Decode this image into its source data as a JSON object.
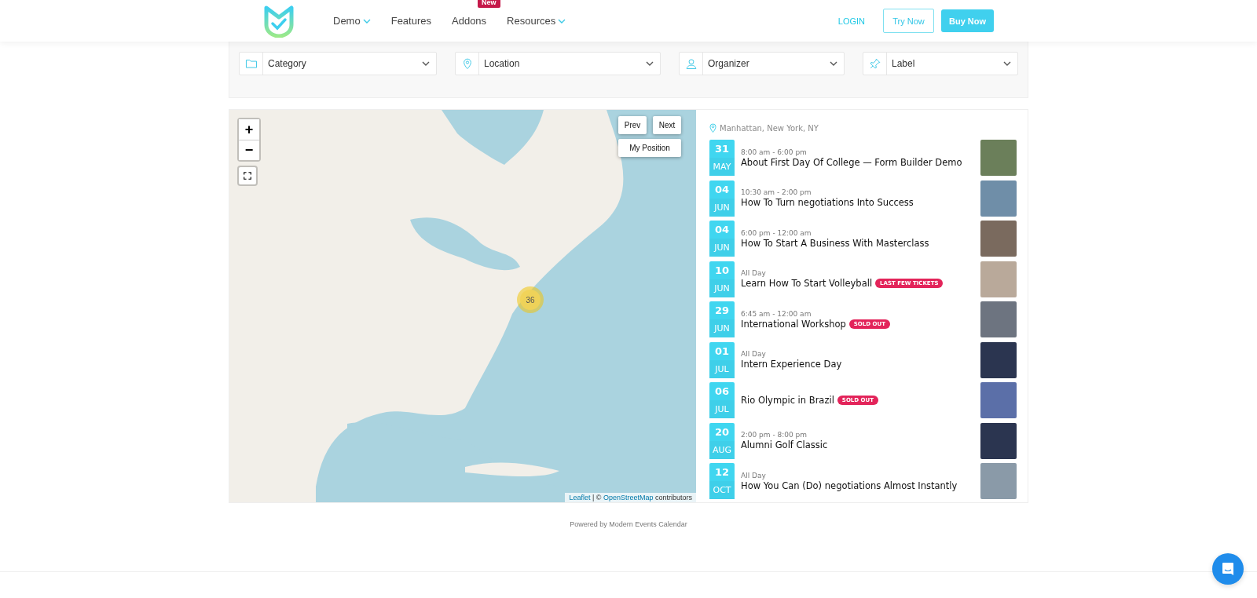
{
  "header": {
    "nav": [
      {
        "label": "Demo",
        "dropdown": true
      },
      {
        "label": "Features",
        "dropdown": false
      },
      {
        "label": "Addons",
        "dropdown": false,
        "badge": "New"
      },
      {
        "label": "Resources",
        "dropdown": true
      }
    ],
    "login": "LOGIN",
    "try_now": "Try Now",
    "buy_now": "Buy Now"
  },
  "filters": [
    {
      "label": "Category"
    },
    {
      "label": "Location"
    },
    {
      "label": "Organizer"
    },
    {
      "label": "Label"
    }
  ],
  "map": {
    "zoom_in": "+",
    "zoom_out": "−",
    "prev": "Prev",
    "next": "Next",
    "my_position": "My Position",
    "cluster": "36",
    "attribution": {
      "link_1": "Leaflet",
      "separator": "| ©",
      "link_2": "OpenStreetMap",
      "suffix": "contributors"
    }
  },
  "events": {
    "location": "Manhattan, New York, NY",
    "items": [
      {
        "day": "31",
        "month": "MAY",
        "time": "8:00 am - 6:00 pm",
        "title": "About First Day Of College — Form Builder Demo"
      },
      {
        "day": "04",
        "month": "JUN",
        "time": "10:30 am - 2:00 pm",
        "title": "How To Turn negotiations Into Success"
      },
      {
        "day": "04",
        "month": "JUN",
        "time": "6:00 pm - 12:00 am",
        "title": "How To Start A Business With Masterclass"
      },
      {
        "day": "10",
        "month": "JUN",
        "time": "All Day",
        "title": "Learn How To Start Volleyball",
        "badge": "LAST FEW TICKETS"
      },
      {
        "day": "29",
        "month": "JUN",
        "time": "6:45 am - 12:00 am",
        "title": "International Workshop",
        "badge": "SOLD OUT"
      },
      {
        "day": "01",
        "month": "JUL",
        "time": "All Day",
        "title": "Intern Experience Day"
      },
      {
        "day": "06",
        "month": "JUL",
        "title": "Rio Olympic in Brazil",
        "badge": "SOLD OUT"
      },
      {
        "day": "20",
        "month": "AUG",
        "time": "2:00 pm - 8:00 pm",
        "title": "Alumni Golf Classic"
      },
      {
        "day": "12",
        "month": "OCT",
        "time": "All Day",
        "title": "How You Can (Do) negotiations Almost Instantly"
      }
    ]
  },
  "footer": "Powered by Modern Events Calendar"
}
